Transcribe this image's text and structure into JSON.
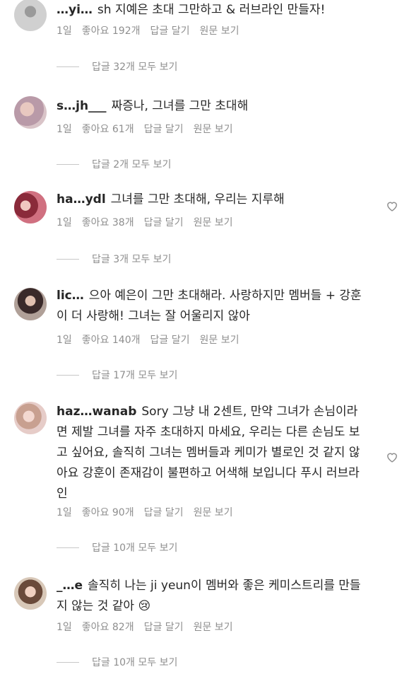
{
  "comments": [
    {
      "username": "…yi…",
      "text": "sh 지예은 초대 그만하고 & 러브라인 만들자!",
      "time": "1일",
      "likes": "좋아요 192개",
      "reply": "답글 달기",
      "original": "원문 보기",
      "view_replies": "답글 32개 모두 보기"
    },
    {
      "username": "s…jh___",
      "text": "짜증나, 그녀를 그만 초대해",
      "time": "1일",
      "likes": "좋아요 61개",
      "reply": "답글 달기",
      "original": "원문 보기",
      "view_replies": "답글 2개 모두 보기"
    },
    {
      "username": "ha…ydl",
      "text": "그녀를 그만 초대해, 우리는 지루해",
      "time": "1일",
      "likes": "좋아요 38개",
      "reply": "답글 달기",
      "original": "원문 보기",
      "view_replies": "답글 3개 모두 보기"
    },
    {
      "username": "lic…",
      "text": "으아 예은이 그만 초대해라. 사랑하지만 멤버들 + 강훈이 더 사랑해! 그녀는 잘 어울리지 않아",
      "time": "1일",
      "likes": "좋아요 140개",
      "reply": "답글 달기",
      "original": "원문 보기",
      "view_replies": "답글 17개 모두 보기"
    },
    {
      "username": "haz…wanab",
      "text": "Sory 그냥 내 2센트, 만약 그녀가 손님이라면 제발 그녀를 자주 초대하지 마세요, 우리는 다른 손님도 보고 싶어요, 솔직히 그녀는 멤버들과 케미가 별로인 것 같지 않아요 강훈이 존재감이 불편하고 어색해 보입니다 푸시 러브라인",
      "time": "1일",
      "likes": "좋아요 90개",
      "reply": "답글 달기",
      "original": "원문 보기",
      "view_replies": "답글 10개 모두 보기"
    },
    {
      "username": "_…e",
      "text": "솔직히 나는 ji yeun이 멤버와 좋은 케미스트리를 만들지 않는 것 같아 😢",
      "time": "1일",
      "likes": "좋아요 82개",
      "reply": "답글 달기",
      "original": "원문 보기",
      "view_replies": "답글 10개 모두 보기"
    }
  ],
  "colors": {
    "text": "#262626",
    "meta": "#8e8e8e",
    "line": "#c7c7c7",
    "heart": "#8e8e8e"
  },
  "icons": {
    "like": "heart-outline-icon"
  }
}
